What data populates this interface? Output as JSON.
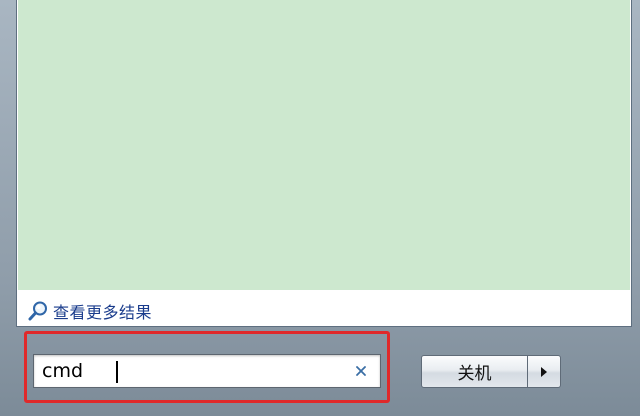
{
  "results": {
    "see_more_label": "查看更多结果"
  },
  "search": {
    "value": "cmd",
    "placeholder": ""
  },
  "shutdown": {
    "label": "关机"
  },
  "icons": {
    "see_more": "magnifier-icon",
    "clear": "clear-x-icon",
    "shutdown_options": "triangle-right-icon"
  },
  "colors": {
    "results_background": "#cde8cf",
    "highlight_border": "#e0292a",
    "link_text": "#1a3c8c",
    "clear_icon": "#3a6ea5"
  }
}
